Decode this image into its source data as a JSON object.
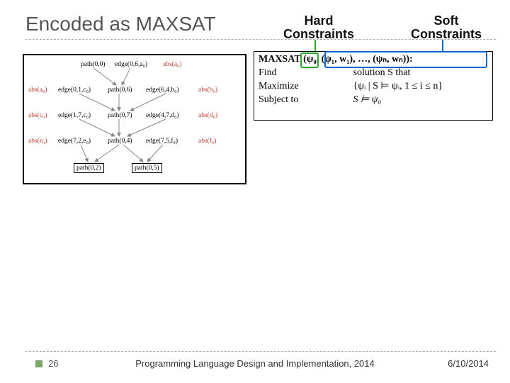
{
  "title": "Encoded as MAXSAT",
  "labels": {
    "hard": "Hard\nConstraints",
    "soft": "Soft\nConstraints"
  },
  "maxsat": {
    "header_prefix": "MAXSAT",
    "header_args": "(ψ₀, (ψ₁, w₁), …, (ψₙ, wₙ)):",
    "find_label": "Find",
    "find_rhs": "solution S that",
    "max_label": "Maximize",
    "max_rhs": "{ψᵢ | S ⊨ ψᵢ, 1 ≤ i ≤ n}",
    "subj_label": "Subject to",
    "subj_rhs": "S ⊨ ψ₀"
  },
  "graph": {
    "n_path00": "path(0,0)",
    "n_edge06a": "edge(0,6,a₀)",
    "n_absa0": "abs(a₀)",
    "n_absa0_l": "abs(a₀)",
    "n_edge01": "edge(0,1,c₀)",
    "n_path06": "path(0,6)",
    "n_edge64": "edge(6,4,b₀)",
    "n_absb0": "abs(b₀)",
    "n_absc0": "abs(c₀)",
    "n_edge17": "edge(1,7,c₀)",
    "n_path07": "path(0,7)",
    "n_edge47": "edge(4,7,d₀)",
    "n_absd0": "abs(d₀)",
    "n_abse0": "abs(e₀)",
    "n_edge72": "edge(7,2,e₀)",
    "n_path04": "path(0,4)",
    "n_edge75": "edge(7,5,f₀)",
    "n_absf0": "abs(f₀)",
    "n_path02": "path(0,2)",
    "n_path05": "path(0,5)"
  },
  "footer": {
    "page": "26",
    "center": "Programming Language Design and Implementation, 2014",
    "date": "6/10/2014"
  }
}
